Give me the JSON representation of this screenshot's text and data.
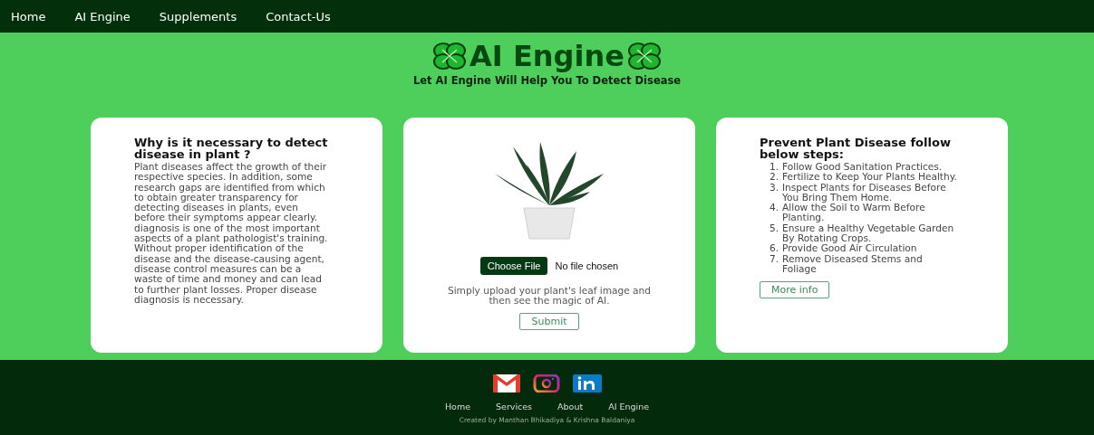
{
  "nav": {
    "links": [
      "Home",
      "AI Engine",
      "Supplements",
      "Contact-Us"
    ]
  },
  "hero": {
    "title": "AI Engine",
    "subtitle": "Let AI Engine Will Help You To Detect Disease"
  },
  "info_card": {
    "heading": "Why is it necessary to detect disease in plant ?",
    "body": "Plant diseases affect the growth of their respective species. In addition, some research gaps are identified from which to obtain greater transparency for detecting diseases in plants, even before their symptoms appear clearly. diagnosis is one of the most important aspects of a plant pathologist's training. Without proper identification of the disease and the disease-causing agent, disease control measures can be a waste of time and money and can lead to further plant losses. Proper disease diagnosis is necessary."
  },
  "upload_card": {
    "choose_button": "Choose File",
    "file_status": "No file chosen",
    "hint": "Simply upload your plant's leaf image and then see the magic of AI.",
    "submit": "Submit"
  },
  "steps_card": {
    "heading": "Prevent Plant Disease follow below steps:",
    "steps": [
      {
        "number": "1.",
        "text": "Follow Good Sanitation Practices."
      },
      {
        "number": "2.",
        "text": "Fertilize to Keep Your Plants Healthy."
      },
      {
        "number": "3.",
        "text": "Inspect Plants for Diseases Before You Bring Them Home."
      },
      {
        "number": "4.",
        "text": "Allow the Soil to Warm Before Planting."
      },
      {
        "number": "5.",
        "text": "Ensure a Healthy Vegetable Garden By Rotating Crops."
      },
      {
        "number": "6.",
        "text": "Provide Good Air Circulation"
      },
      {
        "number": "7.",
        "text": "Remove Diseased Stems and Foliage"
      }
    ],
    "button": "More info"
  },
  "footer": {
    "social": [
      {
        "kind": "mail"
      },
      {
        "kind": "instagram"
      },
      {
        "kind": "linkedin"
      }
    ],
    "links": [
      "Home",
      "Services",
      "About",
      "AI Engine"
    ],
    "credit": "Created by Manthan Bhikadiya & Krishna Baldaniya"
  }
}
